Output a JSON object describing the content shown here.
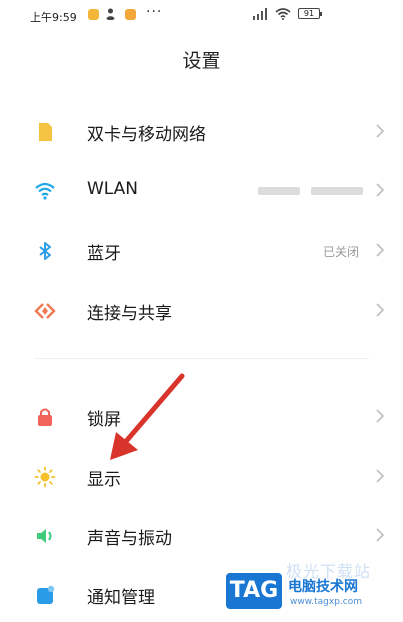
{
  "status_bar": {
    "time": "上午9:59",
    "more": "···",
    "battery": "91"
  },
  "page_title": "设置",
  "settings": [
    {
      "label": "双卡与移动网络",
      "icon": "sim-card-icon",
      "color": "#f5c342"
    },
    {
      "label": "WLAN",
      "icon": "wifi-icon",
      "color": "#22a8e6"
    },
    {
      "label": "蓝牙",
      "icon": "bluetooth-icon",
      "color": "#2d9ee8",
      "value": "已关闭"
    },
    {
      "label": "连接与共享",
      "icon": "connection-share-icon",
      "color": "#f07a55"
    },
    {
      "label": "锁屏",
      "icon": "lock-icon",
      "color": "#f0645c"
    },
    {
      "label": "显示",
      "icon": "sun-icon",
      "color": "#f6c02c"
    },
    {
      "label": "声音与振动",
      "icon": "speaker-icon",
      "color": "#3fca7c"
    },
    {
      "label": "通知管理",
      "icon": "notification-icon",
      "color": "#2a9be6"
    }
  ],
  "watermark": {
    "badge": "TAG",
    "title": "电脑技术网",
    "url": "www.tagxp.com",
    "faded": "极光下载站"
  },
  "colors": {
    "accent_arrow": "#d9342b",
    "chevron": "#bdbdbd",
    "watermark_blue": "#1976d2"
  }
}
